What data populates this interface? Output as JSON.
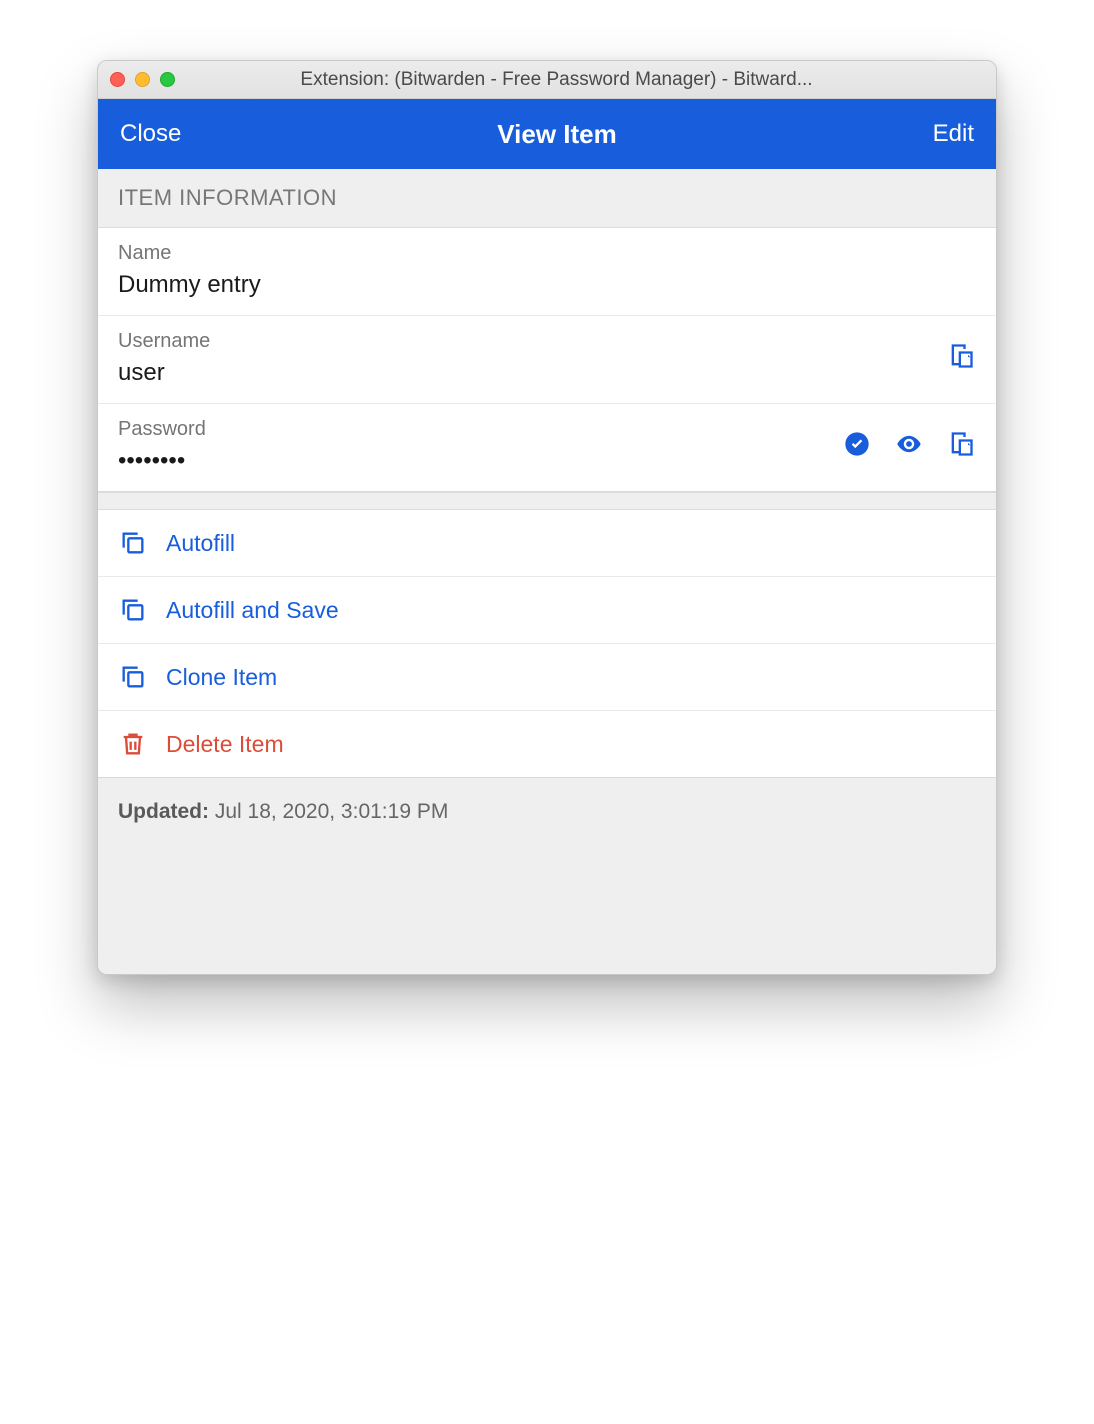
{
  "window": {
    "title": "Extension: (Bitwarden - Free Password Manager) - Bitward..."
  },
  "header": {
    "close": "Close",
    "title": "View Item",
    "edit": "Edit"
  },
  "sections": {
    "item_info_header": "ITEM INFORMATION"
  },
  "fields": {
    "name_label": "Name",
    "name_value": "Dummy entry",
    "username_label": "Username",
    "username_value": "user",
    "password_label": "Password",
    "password_value": "••••••••"
  },
  "actions": {
    "autofill": "Autofill",
    "autofill_save": "Autofill and Save",
    "clone": "Clone Item",
    "delete": "Delete Item"
  },
  "footer": {
    "updated_label": "Updated:",
    "updated_value": "Jul 18, 2020, 3:01:19 PM"
  },
  "colors": {
    "brand": "#175ddc",
    "danger": "#dd4b39"
  }
}
